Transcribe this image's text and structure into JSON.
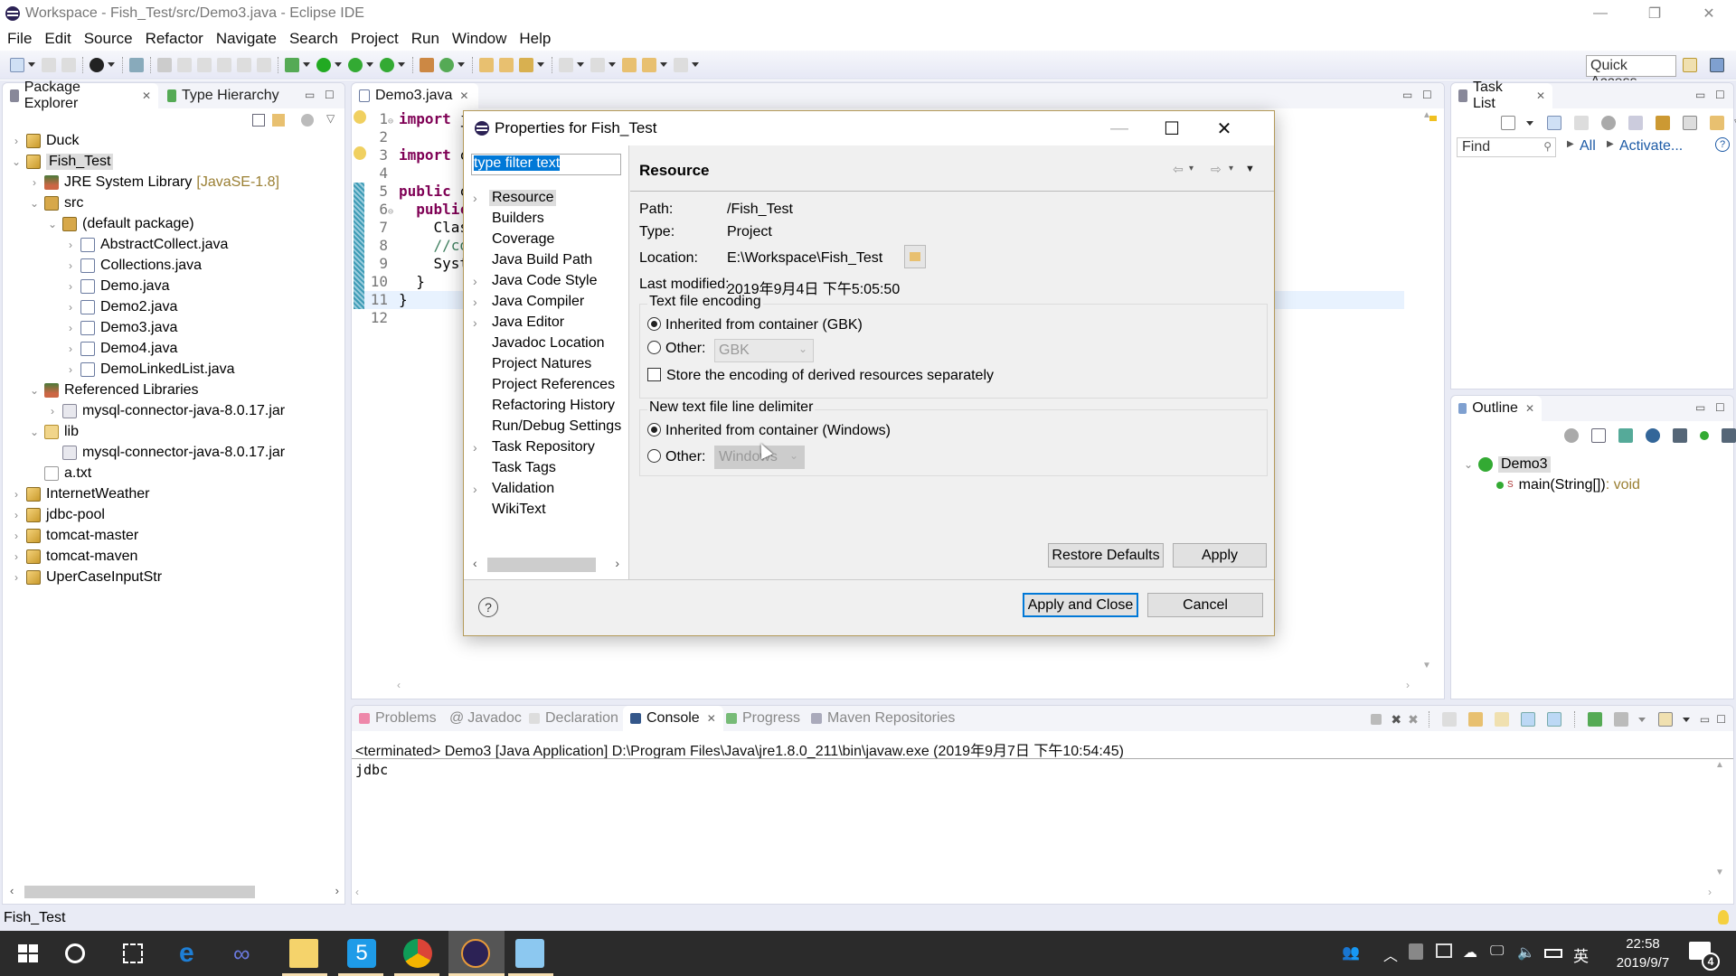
{
  "window": {
    "title": "Workspace - Fish_Test/src/Demo3.java - Eclipse IDE",
    "controls": {
      "minimize": "—",
      "restore": "❐",
      "close": "✕"
    }
  },
  "menu": [
    "File",
    "Edit",
    "Source",
    "Refactor",
    "Navigate",
    "Search",
    "Project",
    "Run",
    "Window",
    "Help"
  ],
  "toolbar": {
    "quick_access": "Quick Access"
  },
  "package_explorer": {
    "tabs": [
      {
        "label": "Package Explorer",
        "active": true
      },
      {
        "label": "Type Hierarchy",
        "active": false
      }
    ],
    "tree": [
      {
        "label": "Duck",
        "icon": "project-icon",
        "level": 0,
        "expanded": false
      },
      {
        "label": "Fish_Test",
        "icon": "project-icon",
        "level": 0,
        "expanded": true,
        "selected": true
      },
      {
        "label": "JRE System Library",
        "suffix": "[JavaSE-1.8]",
        "icon": "library-icon",
        "level": 1,
        "expanded": false
      },
      {
        "label": "src",
        "icon": "source-folder-icon",
        "level": 1,
        "expanded": true
      },
      {
        "label": "(default package)",
        "icon": "package-icon",
        "level": 2,
        "expanded": true
      },
      {
        "label": "AbstractCollect.java",
        "icon": "java-file-icon",
        "level": 3,
        "expanded": false
      },
      {
        "label": "Collections.java",
        "icon": "java-file-icon",
        "level": 3,
        "expanded": false
      },
      {
        "label": "Demo.java",
        "icon": "java-file-icon",
        "level": 3,
        "expanded": false
      },
      {
        "label": "Demo2.java",
        "icon": "java-file-icon",
        "level": 3,
        "expanded": false
      },
      {
        "label": "Demo3.java",
        "icon": "java-file-warning-icon",
        "level": 3,
        "expanded": false
      },
      {
        "label": "Demo4.java",
        "icon": "java-file-icon",
        "level": 3,
        "expanded": false
      },
      {
        "label": "DemoLinkedList.java",
        "icon": "java-file-warning-icon",
        "level": 3,
        "expanded": false
      },
      {
        "label": "Referenced Libraries",
        "icon": "library-icon",
        "level": 1,
        "expanded": true
      },
      {
        "label": "mysql-connector-java-8.0.17.jar",
        "icon": "jar-icon",
        "level": 2,
        "expanded": false
      },
      {
        "label": "lib",
        "icon": "folder-icon",
        "level": 1,
        "expanded": true
      },
      {
        "label": "mysql-connector-java-8.0.17.jar",
        "icon": "jar-file-icon",
        "level": 2,
        "leaf": true
      },
      {
        "label": "a.txt",
        "icon": "text-file-icon",
        "level": 1,
        "leaf": true
      },
      {
        "label": "InternetWeather",
        "icon": "project-icon",
        "level": 0,
        "expanded": false
      },
      {
        "label": "jdbc-pool",
        "icon": "project-icon",
        "level": 0,
        "expanded": false
      },
      {
        "label": "tomcat-master",
        "icon": "project-icon",
        "level": 0,
        "expanded": false
      },
      {
        "label": "tomcat-maven",
        "icon": "project-icon",
        "level": 0,
        "expanded": false
      },
      {
        "label": "UperCaseInputStr",
        "icon": "project-icon",
        "level": 0,
        "expanded": false
      }
    ]
  },
  "editor": {
    "tab": "Demo3.java",
    "lines": [
      {
        "n": "1",
        "text": "import ja",
        "kw": "import"
      },
      {
        "n": "2",
        "text": ""
      },
      {
        "n": "3",
        "text": "import co",
        "kw": "import"
      },
      {
        "n": "4",
        "text": ""
      },
      {
        "n": "5",
        "text": "public cl",
        "kw": "public"
      },
      {
        "n": "6",
        "text": "  public ",
        "kw": "public"
      },
      {
        "n": "7",
        "text": "    Class"
      },
      {
        "n": "8",
        "text": "    //cor",
        "comment": true
      },
      {
        "n": "9",
        "text": "    Syste"
      },
      {
        "n": "10",
        "text": "  }"
      },
      {
        "n": "11",
        "text": "}"
      },
      {
        "n": "12",
        "text": ""
      }
    ]
  },
  "task_list": {
    "tab": "Task List",
    "find_placeholder": "Find",
    "all": "All",
    "activate": "Activate..."
  },
  "outline": {
    "tab": "Outline",
    "class": "Demo3",
    "method": "main(String[])",
    "method_type": " : void"
  },
  "bottom": {
    "tabs": [
      {
        "label": "Problems",
        "active": false
      },
      {
        "label": "Javadoc",
        "active": false
      },
      {
        "label": "Declaration",
        "active": false
      },
      {
        "label": "Console",
        "active": true
      },
      {
        "label": "Progress",
        "active": false
      },
      {
        "label": "Maven Repositories",
        "active": false
      }
    ],
    "console_header": "<terminated> Demo3 [Java Application] D:\\Program Files\\Java\\jre1.8.0_211\\bin\\javaw.exe (2019年9月7日 下午10:54:45)",
    "console_output": "jdbc"
  },
  "status": {
    "text": "Fish_Test"
  },
  "dialog": {
    "title": "Properties for Fish_Test",
    "filter_text": "type filter text",
    "nav": [
      {
        "label": "Resource",
        "expandable": true,
        "active": true
      },
      {
        "label": "Builders",
        "expandable": false
      },
      {
        "label": "Coverage",
        "expandable": false
      },
      {
        "label": "Java Build Path",
        "expandable": false
      },
      {
        "label": "Java Code Style",
        "expandable": true
      },
      {
        "label": "Java Compiler",
        "expandable": true
      },
      {
        "label": "Java Editor",
        "expandable": true
      },
      {
        "label": "Javadoc Location",
        "expandable": false
      },
      {
        "label": "Project Natures",
        "expandable": false
      },
      {
        "label": "Project References",
        "expandable": false
      },
      {
        "label": "Refactoring History",
        "expandable": false
      },
      {
        "label": "Run/Debug Settings",
        "expandable": false
      },
      {
        "label": "Task Repository",
        "expandable": true
      },
      {
        "label": "Task Tags",
        "expandable": false
      },
      {
        "label": "Validation",
        "expandable": true
      },
      {
        "label": "WikiText",
        "expandable": false
      }
    ],
    "page_title": "Resource",
    "fields": {
      "path_label": "Path:",
      "path": "/Fish_Test",
      "type_label": "Type:",
      "type": "Project",
      "location_label": "Location:",
      "location": "E:\\Workspace\\Fish_Test",
      "modified_label": "Last modified:",
      "modified": "2019年9月4日 下午5:05:50"
    },
    "encoding": {
      "group": "Text file encoding",
      "inherited": "Inherited from container (GBK)",
      "inherited_selected": true,
      "other": "Other:",
      "other_value": "GBK",
      "store_derived": "Store the encoding of derived resources separately",
      "store_derived_checked": false
    },
    "delimiter": {
      "group": "New text file line delimiter",
      "inherited": "Inherited from container (Windows)",
      "inherited_selected": true,
      "other": "Other:",
      "other_value": "Windows"
    },
    "buttons": {
      "restore": "Restore Defaults",
      "apply": "Apply",
      "apply_close": "Apply and Close",
      "cancel": "Cancel"
    },
    "help": "?"
  },
  "taskbar": {
    "time": "22:58",
    "date": "2019/9/7",
    "ime": "英",
    "notifications": "4"
  }
}
